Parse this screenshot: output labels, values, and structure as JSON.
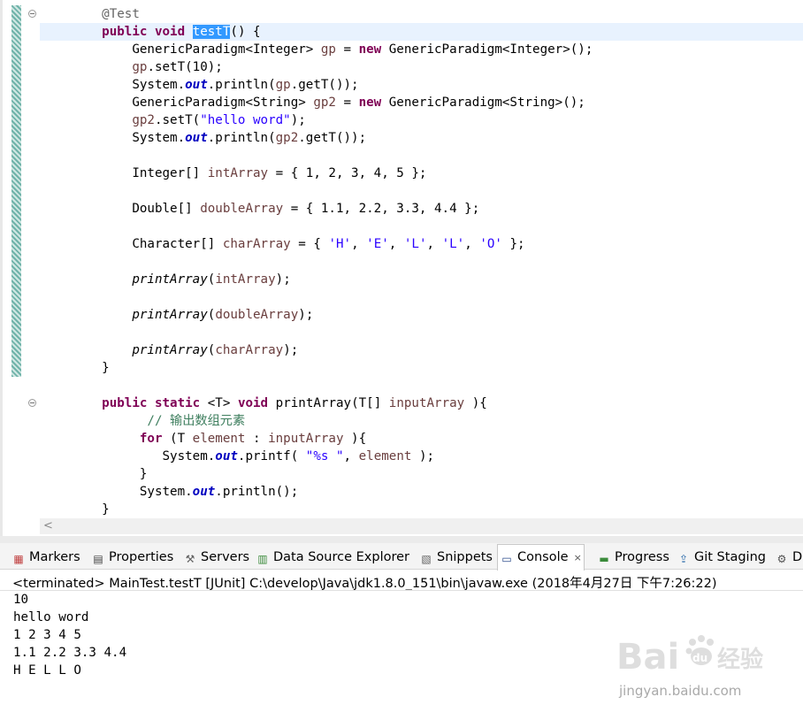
{
  "editor": {
    "lines": [
      [
        {
          "c": "ann",
          "t": "    @Test"
        }
      ],
      [
        {
          "c": "",
          "t": "    "
        },
        {
          "c": "kw",
          "t": "public"
        },
        {
          "c": "",
          "t": " "
        },
        {
          "c": "kw",
          "t": "void"
        },
        {
          "c": "",
          "t": " "
        },
        {
          "c": "sel",
          "t": "testT"
        },
        {
          "c": "",
          "t": "() {"
        }
      ],
      [
        {
          "c": "",
          "t": "        GenericParadigm<Integer> "
        },
        {
          "c": "var",
          "t": "gp"
        },
        {
          "c": "",
          "t": " = "
        },
        {
          "c": "kw",
          "t": "new"
        },
        {
          "c": "",
          "t": " GenericParadigm<Integer>();"
        }
      ],
      [
        {
          "c": "",
          "t": "        "
        },
        {
          "c": "var",
          "t": "gp"
        },
        {
          "c": "",
          "t": ".setT(10);"
        }
      ],
      [
        {
          "c": "",
          "t": "        System."
        },
        {
          "c": "fld",
          "t": "out"
        },
        {
          "c": "",
          "t": ".println("
        },
        {
          "c": "var",
          "t": "gp"
        },
        {
          "c": "",
          "t": ".getT());"
        }
      ],
      [
        {
          "c": "",
          "t": "        GenericParadigm<String> "
        },
        {
          "c": "var",
          "t": "gp2"
        },
        {
          "c": "",
          "t": " = "
        },
        {
          "c": "kw",
          "t": "new"
        },
        {
          "c": "",
          "t": " GenericParadigm<String>();"
        }
      ],
      [
        {
          "c": "",
          "t": "        "
        },
        {
          "c": "var",
          "t": "gp2"
        },
        {
          "c": "",
          "t": ".setT("
        },
        {
          "c": "str",
          "t": "\"hello word\""
        },
        {
          "c": "",
          "t": ");"
        }
      ],
      [
        {
          "c": "",
          "t": "        System."
        },
        {
          "c": "fld",
          "t": "out"
        },
        {
          "c": "",
          "t": ".println("
        },
        {
          "c": "var",
          "t": "gp2"
        },
        {
          "c": "",
          "t": ".getT());"
        }
      ],
      [
        {
          "c": "",
          "t": ""
        }
      ],
      [
        {
          "c": "",
          "t": "        Integer[] "
        },
        {
          "c": "var",
          "t": "intArray"
        },
        {
          "c": "",
          "t": " = { 1, 2, 3, 4, 5 };"
        }
      ],
      [
        {
          "c": "",
          "t": ""
        }
      ],
      [
        {
          "c": "",
          "t": "        Double[] "
        },
        {
          "c": "var",
          "t": "doubleArray"
        },
        {
          "c": "",
          "t": " = { 1.1, 2.2, 3.3, 4.4 };"
        }
      ],
      [
        {
          "c": "",
          "t": ""
        }
      ],
      [
        {
          "c": "",
          "t": "        Character[] "
        },
        {
          "c": "var",
          "t": "charArray"
        },
        {
          "c": "",
          "t": " = { "
        },
        {
          "c": "str",
          "t": "'H'"
        },
        {
          "c": "",
          "t": ", "
        },
        {
          "c": "str",
          "t": "'E'"
        },
        {
          "c": "",
          "t": ", "
        },
        {
          "c": "str",
          "t": "'L'"
        },
        {
          "c": "",
          "t": ", "
        },
        {
          "c": "str",
          "t": "'L'"
        },
        {
          "c": "",
          "t": ", "
        },
        {
          "c": "str",
          "t": "'O'"
        },
        {
          "c": "",
          "t": " };"
        }
      ],
      [
        {
          "c": "",
          "t": ""
        }
      ],
      [
        {
          "c": "",
          "t": "        "
        },
        {
          "c": "ital",
          "t": "printArray"
        },
        {
          "c": "",
          "t": "("
        },
        {
          "c": "var",
          "t": "intArray"
        },
        {
          "c": "",
          "t": ");"
        }
      ],
      [
        {
          "c": "",
          "t": ""
        }
      ],
      [
        {
          "c": "",
          "t": "        "
        },
        {
          "c": "ital",
          "t": "printArray"
        },
        {
          "c": "",
          "t": "("
        },
        {
          "c": "var",
          "t": "doubleArray"
        },
        {
          "c": "",
          "t": ");"
        }
      ],
      [
        {
          "c": "",
          "t": ""
        }
      ],
      [
        {
          "c": "",
          "t": "        "
        },
        {
          "c": "ital",
          "t": "printArray"
        },
        {
          "c": "",
          "t": "("
        },
        {
          "c": "var",
          "t": "charArray"
        },
        {
          "c": "",
          "t": ");"
        }
      ],
      [
        {
          "c": "",
          "t": "    }"
        }
      ],
      [
        {
          "c": "",
          "t": ""
        }
      ],
      [
        {
          "c": "",
          "t": "    "
        },
        {
          "c": "kw",
          "t": "public"
        },
        {
          "c": "",
          "t": " "
        },
        {
          "c": "kw",
          "t": "static"
        },
        {
          "c": "",
          "t": " <T> "
        },
        {
          "c": "kw",
          "t": "void"
        },
        {
          "c": "",
          "t": " printArray(T[] "
        },
        {
          "c": "var",
          "t": "inputArray"
        },
        {
          "c": "",
          "t": " ){"
        }
      ],
      [
        {
          "c": "cmt",
          "t": "          // 输出数组元素"
        }
      ],
      [
        {
          "c": "",
          "t": "         "
        },
        {
          "c": "kw",
          "t": "for"
        },
        {
          "c": "",
          "t": " (T "
        },
        {
          "c": "var",
          "t": "element"
        },
        {
          "c": "",
          "t": " : "
        },
        {
          "c": "var",
          "t": "inputArray"
        },
        {
          "c": "",
          "t": " ){"
        }
      ],
      [
        {
          "c": "",
          "t": "            System."
        },
        {
          "c": "fld",
          "t": "out"
        },
        {
          "c": "",
          "t": ".printf( "
        },
        {
          "c": "str",
          "t": "\"%s \""
        },
        {
          "c": "",
          "t": ", "
        },
        {
          "c": "var",
          "t": "element"
        },
        {
          "c": "",
          "t": " );"
        }
      ],
      [
        {
          "c": "",
          "t": "         }"
        }
      ],
      [
        {
          "c": "",
          "t": "         System."
        },
        {
          "c": "fld",
          "t": "out"
        },
        {
          "c": "",
          "t": ".println();"
        }
      ],
      [
        {
          "c": "",
          "t": "    }"
        }
      ]
    ],
    "hscroll_arrow": "<"
  },
  "tabs": [
    {
      "label": "Markers",
      "icon": "markers-icon",
      "glyph": "▦",
      "color": "#c04040"
    },
    {
      "label": "Properties",
      "icon": "properties-icon",
      "glyph": "▤",
      "color": "#404040"
    },
    {
      "label": "Servers",
      "icon": "servers-icon",
      "glyph": "⚒",
      "color": "#606060"
    },
    {
      "label": "Data Source Explorer",
      "icon": "data-source-icon",
      "glyph": "▥",
      "color": "#3a8a3a"
    },
    {
      "label": "Snippets",
      "icon": "snippets-icon",
      "glyph": "▧",
      "color": "#606060"
    },
    {
      "label": "Console",
      "icon": "console-icon",
      "glyph": "▭",
      "color": "#2a4a8a",
      "active": true,
      "close": "×"
    },
    {
      "label": "Progress",
      "icon": "progress-icon",
      "glyph": "▬",
      "color": "#3a8a3a"
    },
    {
      "label": "Git Staging",
      "icon": "git-staging-icon",
      "glyph": "⇪",
      "color": "#2a6aaa"
    },
    {
      "label": "D",
      "icon": "gear-icon",
      "glyph": "⚙",
      "color": "#505050"
    }
  ],
  "console": {
    "title": "<terminated> MainTest.testT [JUnit] C:\\develop\\Java\\jdk1.8.0_151\\bin\\javaw.exe (2018年4月27日 下午7:26:22)",
    "output": [
      "10",
      "hello word",
      "1 2 3 4 5",
      "1.1 2.2 3.3 4.4",
      "H E L L O"
    ]
  },
  "watermark": {
    "logo": "Bai",
    "paw": "du",
    "brand": "经验",
    "url": "jingyan.baidu.com"
  }
}
